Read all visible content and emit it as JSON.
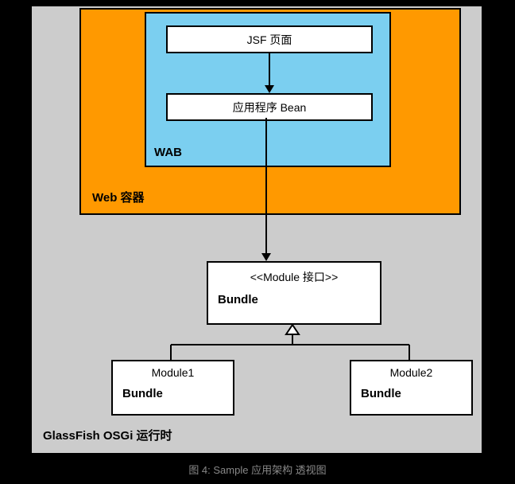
{
  "outer": {
    "label": "GlassFish OSGi 运行时"
  },
  "webContainer": {
    "label": "Web 容器"
  },
  "wab": {
    "label": "WAB",
    "jsf": "JSF 页面",
    "bean": "应用程序 Bean"
  },
  "bundle": {
    "stereotype": "<<Module 接口>>",
    "label": "Bundle"
  },
  "module1": {
    "name": "Module1",
    "label": "Bundle"
  },
  "module2": {
    "name": "Module2",
    "label": "Bundle"
  },
  "caption": "图 4: Sample 应用架构 透视图"
}
